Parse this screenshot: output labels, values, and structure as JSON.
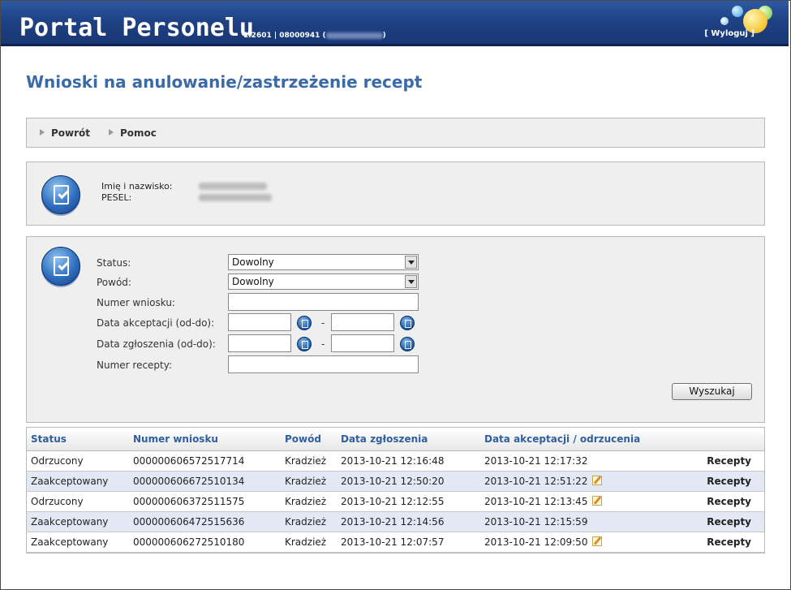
{
  "header": {
    "app_title": "Portal Personelu",
    "version": "1.2601 | 08000941 (",
    "version_end": ")",
    "logout": "[ Wyloguj ]"
  },
  "page_title": "Wnioski na anulowanie/zastrzeżenie recept",
  "nav": {
    "back": "Powrót",
    "help": "Pomoc"
  },
  "person": {
    "name_label": "Imię i nazwisko:",
    "pesel_label": "PESEL:"
  },
  "search": {
    "status_label": "Status:",
    "status_value": "Dowolny",
    "reason_label": "Powód:",
    "reason_value": "Dowolny",
    "request_no_label": "Numer wniosku:",
    "accept_date_label": "Data akceptacji (od-do):",
    "report_date_label": "Data zgłoszenia (od-do):",
    "prescription_no_label": "Numer recepty:",
    "range_sep": "-",
    "search_button": "Wyszukaj"
  },
  "table": {
    "headers": [
      "Status",
      "Numer wniosku",
      "Powód",
      "Data zgłoszenia",
      "Data akceptacji / odrzucenia"
    ],
    "rows": [
      {
        "status": "Odrzucony",
        "number": "000000606572517714",
        "reason": "Kradzież",
        "reported": "2013-10-21 12:16:48",
        "decided": "2013-10-21 12:17:32",
        "link": "Recepty"
      },
      {
        "status": "Zaakceptowany",
        "number": "000000606672510134",
        "reason": "Kradzież",
        "reported": "2013-10-21 12:50:20",
        "decided": "2013-10-21 12:51:22",
        "link": "Recepty"
      },
      {
        "status": "Odrzucony",
        "number": "000000606372511575",
        "reason": "Kradzież",
        "reported": "2013-10-21 12:12:55",
        "decided": "2013-10-21 12:13:45",
        "link": "Recepty"
      },
      {
        "status": "Zaakceptowany",
        "number": "000000606472515636",
        "reason": "Kradzież",
        "reported": "2013-10-21 12:14:56",
        "decided": "2013-10-21 12:15:59",
        "link": "Recepty"
      },
      {
        "status": "Zaakceptowany",
        "number": "000000606272510180",
        "reason": "Kradzież",
        "reported": "2013-10-21 12:07:57",
        "decided": "2013-10-21 12:09:50",
        "link": "Recepty"
      }
    ]
  },
  "colors": {
    "header_blue": "#1f4285",
    "title_blue": "#3a6aa8",
    "row_alt": "#e2e9f5"
  }
}
